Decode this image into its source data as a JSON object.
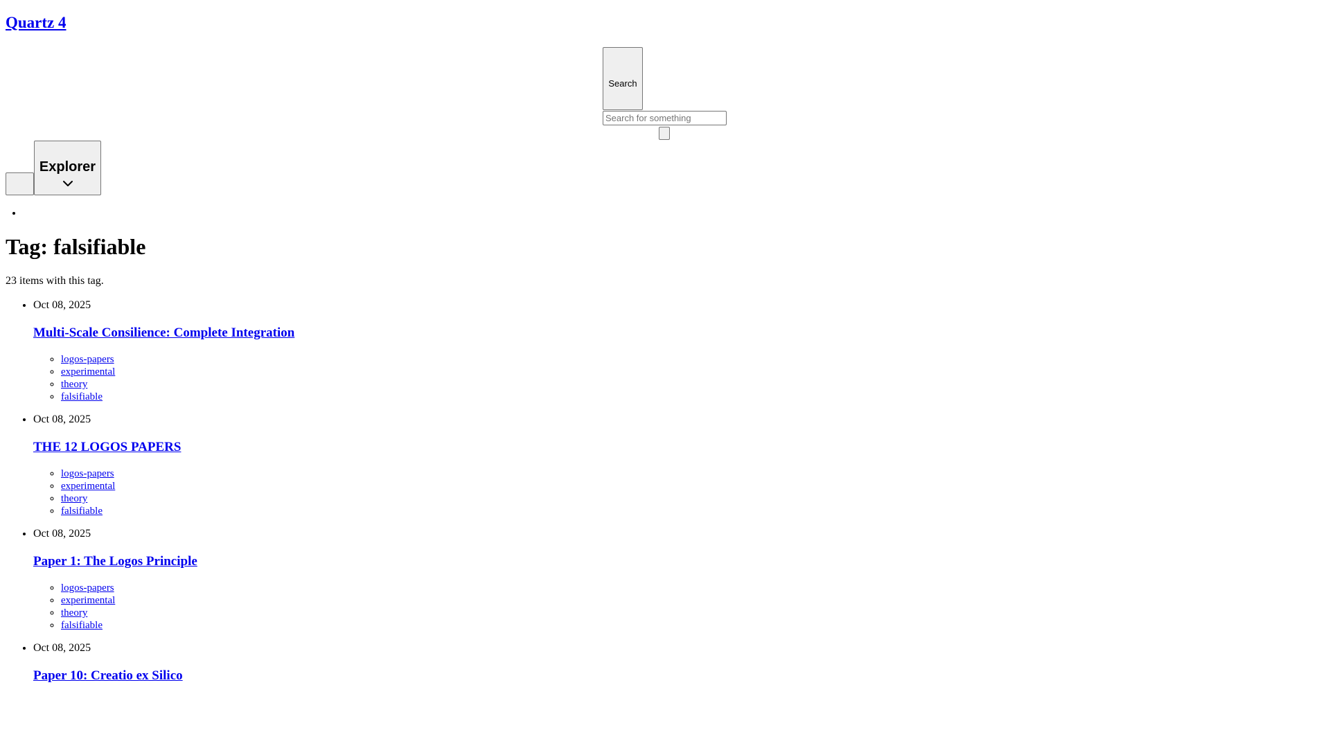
{
  "header": {
    "site_title": "Quartz 4"
  },
  "search": {
    "button_label": "Search",
    "placeholder": "Search for something",
    "value": ""
  },
  "explorer": {
    "title": "Explorer",
    "toggle_icon": "chevron-down-icon"
  },
  "main": {
    "title": "Tag: falsifiable",
    "count_text": "23 items with this tag.",
    "posts": [
      {
        "date": "Oct 08, 2025",
        "title": "Multi-Scale Consilience: Complete Integration",
        "tags": [
          "logos-papers",
          "experimental",
          "theory",
          "falsifiable"
        ]
      },
      {
        "date": "Oct 08, 2025",
        "title": "THE 12 LOGOS PAPERS",
        "tags": [
          "logos-papers",
          "experimental",
          "theory",
          "falsifiable"
        ]
      },
      {
        "date": "Oct 08, 2025",
        "title": "Paper 1: The Logos Principle",
        "tags": [
          "logos-papers",
          "experimental",
          "theory",
          "falsifiable"
        ]
      },
      {
        "date": "Oct 08, 2025",
        "title": "Paper 10: Creatio ex Silico",
        "tags": []
      }
    ]
  },
  "colors": {
    "link": "#0000ee",
    "button_bg": "#efefef",
    "button_border": "#767676"
  }
}
